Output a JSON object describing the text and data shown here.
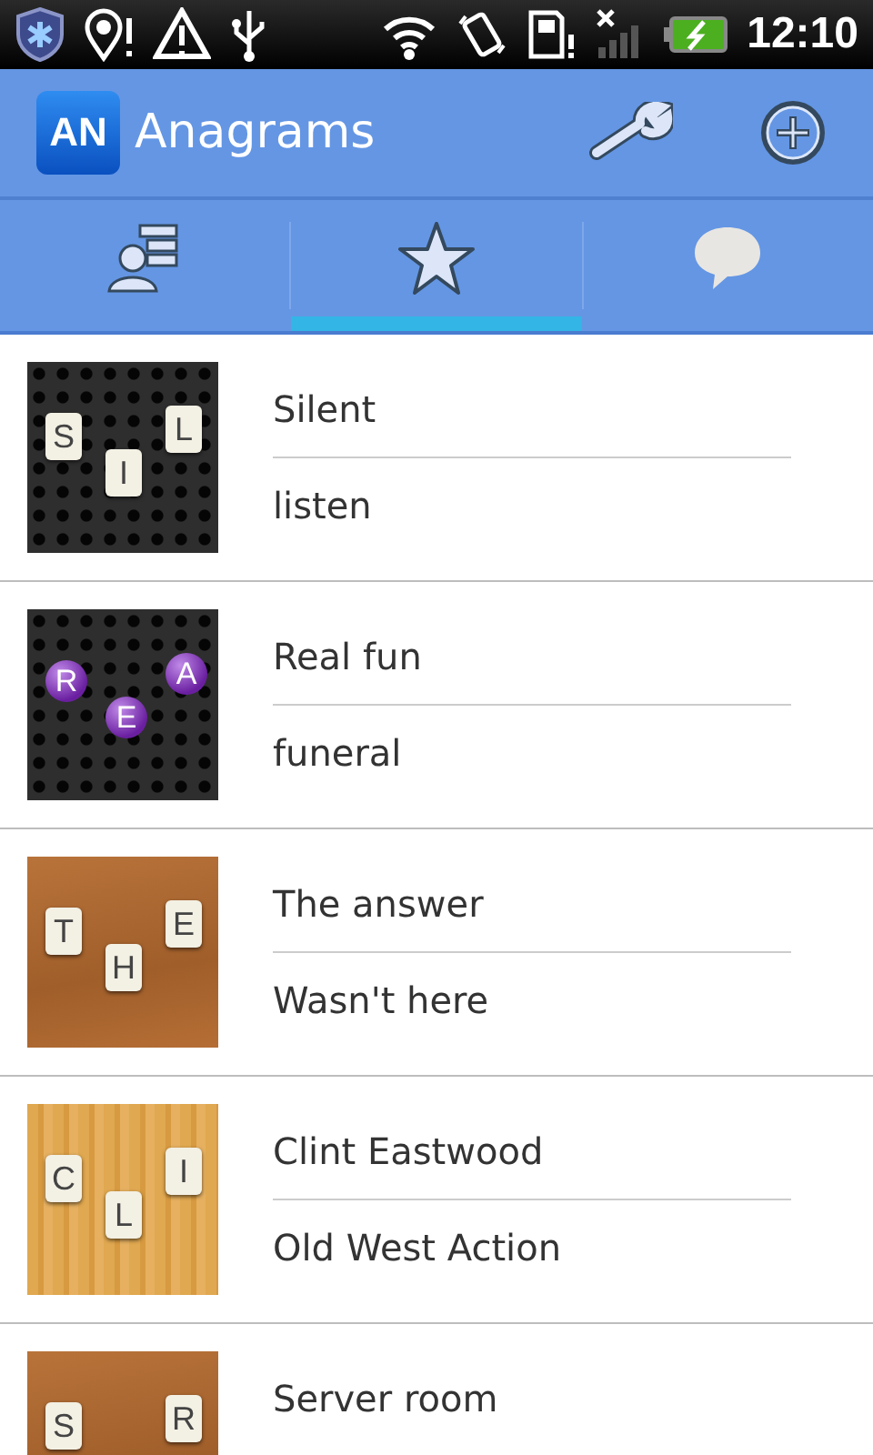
{
  "status_bar": {
    "time": "12:10"
  },
  "action_bar": {
    "logo": "AN",
    "title": "Anagrams"
  },
  "tabs": [
    {
      "kind": "contacts",
      "selected": false
    },
    {
      "kind": "star",
      "selected": true
    },
    {
      "kind": "chat",
      "selected": false
    }
  ],
  "anagrams": [
    {
      "thumbnail": {
        "kind": "mesh_tiles",
        "letters": [
          "S",
          "I",
          "L"
        ]
      },
      "phrase": "Silent",
      "anagram": "listen"
    },
    {
      "thumbnail": {
        "kind": "mesh_balls",
        "letters": [
          "R",
          "E",
          "A"
        ]
      },
      "phrase": "Real fun",
      "anagram": "funeral"
    },
    {
      "thumbnail": {
        "kind": "leather_tiles",
        "letters": [
          "T",
          "H",
          "E"
        ]
      },
      "phrase": "The answer",
      "anagram": "Wasn't here"
    },
    {
      "thumbnail": {
        "kind": "wood_tiles",
        "letters": [
          "C",
          "L",
          "I"
        ]
      },
      "phrase": "Clint Eastwood",
      "anagram": "Old West Action"
    },
    {
      "thumbnail": {
        "kind": "leather_tiles",
        "letters": [
          "S",
          "R"
        ]
      },
      "phrase": "Server room"
    }
  ]
}
